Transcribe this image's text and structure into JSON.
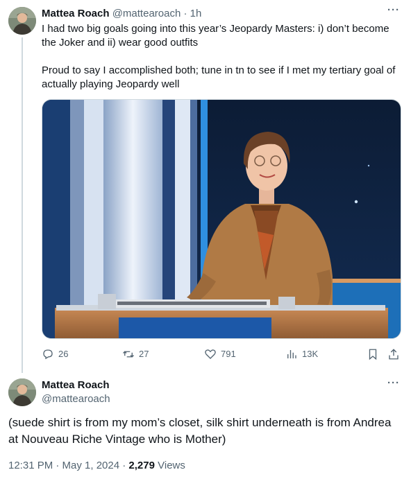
{
  "tweet": {
    "author_name": "Mattea Roach",
    "author_handle": "@mattearoach",
    "separator": "·",
    "time_ago": "1h",
    "paragraph1": "I had two big goals going into this year’s Jeopardy Masters: i) don’t become the Joker and ii) wear good outfits",
    "paragraph2": "Proud to say I accomplished both; tune in tn to see if I met my tertiary goal of actually playing Jeopardy well",
    "more_label": "···",
    "actions": {
      "replies": "26",
      "reposts": "27",
      "likes": "791",
      "views": "13K"
    },
    "icons": [
      "reply-icon",
      "repost-icon",
      "like-icon",
      "views-icon",
      "bookmark-icon",
      "share-icon"
    ]
  },
  "reply": {
    "author_name": "Mattea Roach",
    "author_handle": "@mattearoach",
    "more_label": "···",
    "text": "(suede shirt is from my mom’s closet, silk shirt underneath is from Andrea at Nouveau Riche Vintage who is Mother)",
    "timestamp": "12:31 PM · May 1, 2024 · ",
    "views_count": "2,279",
    "views_label": " Views"
  },
  "colors": {
    "text_primary": "#0f1419",
    "text_secondary": "#536471",
    "thread_line": "#cfd9de",
    "stage_blue": "#1d6fb8",
    "jacket": "#b07a45"
  }
}
